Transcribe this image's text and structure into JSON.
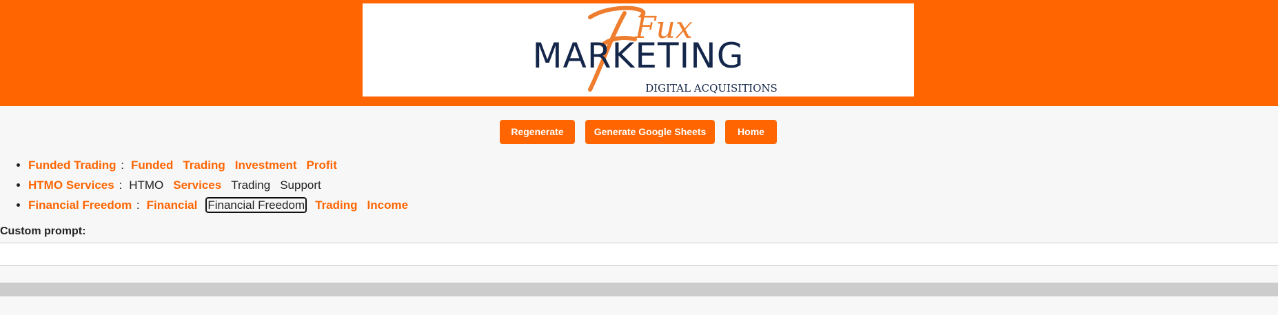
{
  "logo": {
    "script_word": "Fux",
    "main_word": "MARKETING",
    "tagline": "DIGITAL ACQUISITIONS"
  },
  "buttons": {
    "regenerate": "Regenerate",
    "google_sheets": "Generate Google Sheets",
    "home": "Home"
  },
  "topics": [
    {
      "title": "Funded Trading",
      "keywords": [
        {
          "text": "Funded",
          "highlight": true
        },
        {
          "text": "Trading",
          "highlight": true
        },
        {
          "text": "Investment",
          "highlight": true
        },
        {
          "text": "Profit",
          "highlight": true
        }
      ]
    },
    {
      "title": "HTMO Services",
      "keywords": [
        {
          "text": "HTMO",
          "highlight": false
        },
        {
          "text": "Services",
          "highlight": true
        },
        {
          "text": "Trading",
          "highlight": false
        },
        {
          "text": "Support",
          "highlight": false
        }
      ]
    },
    {
      "title": "Financial Freedom",
      "keywords": [
        {
          "text": "Financial",
          "highlight": true
        },
        {
          "text": "Financial Freedom",
          "highlight": false,
          "selected": true
        },
        {
          "text": "Trading",
          "highlight": true
        },
        {
          "text": "Income",
          "highlight": true
        }
      ]
    }
  ],
  "custom_prompt": {
    "label": "Custom prompt:",
    "value": "",
    "placeholder": ""
  },
  "colors": {
    "brand_orange": "#ff6602",
    "logo_navy": "#14264a",
    "logo_orange": "#ef7d2e"
  }
}
